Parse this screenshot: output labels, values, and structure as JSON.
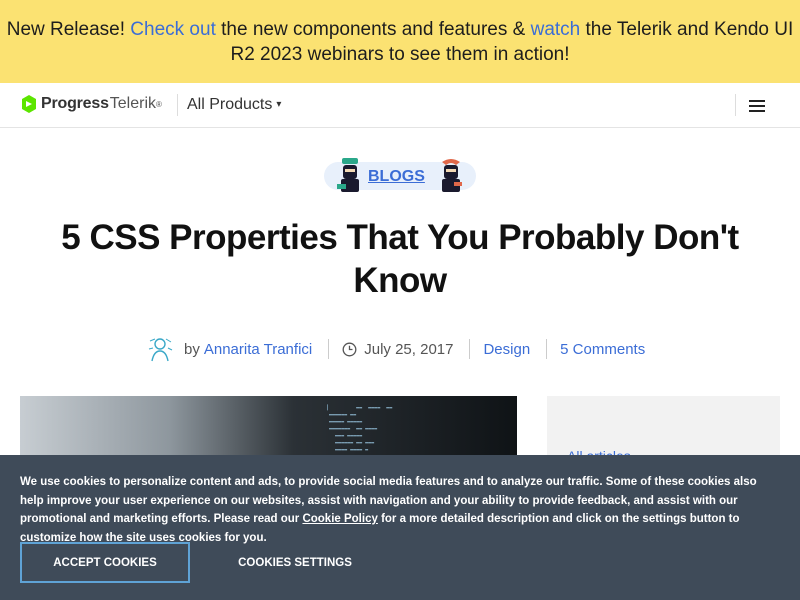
{
  "banner": {
    "part1": "New Release! ",
    "link1": "Check out",
    "part2": " the new components and features & ",
    "link2": "watch",
    "part3": " the Telerik and Kendo UI R2 2023 webinars to see them in action!"
  },
  "nav": {
    "logo_progress": "Progress",
    "logo_telerik": "Telerik",
    "logo_reg": "®",
    "all_products": "All Products",
    "caret": "▾"
  },
  "badge": {
    "label": "BLOGS"
  },
  "article": {
    "title": "5 CSS Properties That You Probably Don't Know",
    "by": "by",
    "author": "Annarita Tranfici",
    "date": "July 25, 2017",
    "category": "Design",
    "comments": "5 Comments"
  },
  "sidebar": {
    "link": "All articles"
  },
  "cookie": {
    "text1": "We use cookies to personalize content and ads, to provide social media features and to analyze our traffic. Some of these cookies also help improve your user experience on our websites, assist with navigation and your ability to provide feedback, and assist with our promotional and marketing efforts. Please read our ",
    "policy_link": "Cookie Policy",
    "text2": " for a more detailed description and click on the settings button to customize how the site uses cookies for you.",
    "accept_label": "ACCEPT COOKIES",
    "settings_label": "COOKIES SETTINGS"
  },
  "colors": {
    "banner_bg": "#fbe272",
    "link": "#3b6dd6",
    "cookie_bg": "#3f4b59",
    "accept_border": "#5fa3d6",
    "logo_green": "#5ce500"
  },
  "icons": [
    "progress-logo-icon",
    "ninja-left-icon",
    "ninja-right-icon",
    "author-avatar",
    "clock-icon",
    "hamburger-menu-icon"
  ]
}
